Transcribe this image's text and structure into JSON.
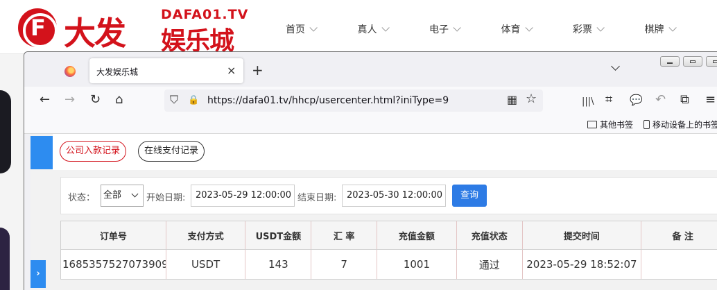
{
  "site": {
    "logo_mark": "F",
    "logo_main": "大发",
    "logo_domain": "DAFA01.TV",
    "logo_sub": "娱乐城",
    "nav": [
      {
        "label": "首页"
      },
      {
        "label": "真人"
      },
      {
        "label": "电子"
      },
      {
        "label": "体育"
      },
      {
        "label": "彩票"
      },
      {
        "label": "棋牌"
      }
    ]
  },
  "browser": {
    "tab_title": "大发娱乐城",
    "url": "https://dafa01.tv/hhcp/usercenter.html?iniType=9",
    "bookmarks": [
      {
        "label": "其他书签"
      },
      {
        "label": "移动设备上的书签"
      }
    ],
    "icons": {
      "back": "←",
      "forward": "→",
      "reload": "↻",
      "home": "⌂",
      "shield": "⛉",
      "lock": "🔒",
      "qr": "▦",
      "star": "☆",
      "library": "|||\\",
      "crop": "⌗",
      "chat": "💬",
      "undo": "↶",
      "extensions": "⧉",
      "menu": "≡",
      "close": "×",
      "newtab": "+"
    }
  },
  "records": {
    "tabs": [
      {
        "label": "公司入款记录",
        "active": true
      },
      {
        "label": "在线支付记录",
        "active": false
      }
    ],
    "filter": {
      "status_label": "状态：",
      "status_value": "全部",
      "start_label": "开始日期:",
      "start_value": "2023-05-29 12:00:00",
      "end_label": "结束日期:",
      "end_value": "2023-05-30 12:00:00",
      "query_button": "查询"
    },
    "columns": [
      "订单号",
      "支付方式",
      "USDT金额",
      "汇 率",
      "充值金额",
      "充值状态",
      "提交时间",
      "备 注"
    ],
    "rows": [
      [
        "1685357527073909",
        "USDT",
        "143",
        "7",
        "1001",
        "通过",
        "2023-05-29 18:52:07",
        ""
      ]
    ]
  },
  "colors": {
    "brand_red": "#d3121b",
    "primary_blue": "#2d7be5"
  }
}
